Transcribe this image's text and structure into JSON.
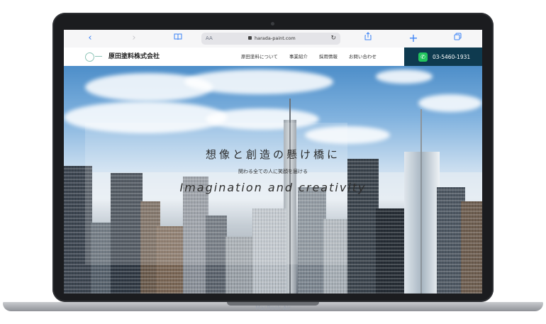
{
  "browser": {
    "url": "harada-paint.com",
    "aa_label": "AA",
    "icons": [
      "back-icon",
      "forward-icon",
      "bookmarks-icon",
      "lock-icon",
      "reload-icon",
      "share-icon",
      "new-tab-icon",
      "tabs-icon"
    ]
  },
  "site": {
    "company_name": "原田塗料株式会社",
    "nav": [
      "原田塗料について",
      "事業紹介",
      "採用情報",
      "お問い合わせ"
    ],
    "phone": "03-5460-1931"
  },
  "hero": {
    "title": "想像と創造の懸け橋に",
    "subtitle": "関わる全ての人に笑顔を届ける",
    "english": "Imagination and creativity"
  },
  "device": {
    "label": "MacBook Air"
  },
  "colors": {
    "header_phone_bg": "#0e3a4f",
    "phone_icon": "#22c55e",
    "browser_accent": "#3b82f6"
  }
}
